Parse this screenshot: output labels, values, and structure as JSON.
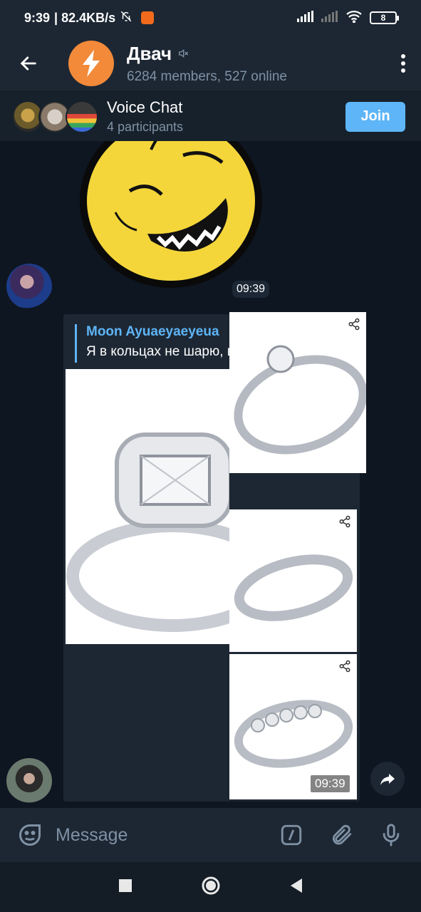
{
  "status": {
    "time": "9:39",
    "speed": "| 82.4KB/s",
    "battery": "8"
  },
  "header": {
    "title": "Двач",
    "subtitle": "6284 members, 527 online"
  },
  "voice_chat": {
    "title": "Voice Chat",
    "participants": "4 participants",
    "join_label": "Join"
  },
  "messages": {
    "sticker_time": "09:39",
    "reply_name": "Moon Ayuaeyaeyeua",
    "reply_text": "Я в кольцах не шарю, висиум пе",
    "album_time": "09:39"
  },
  "input": {
    "placeholder": "Message"
  },
  "colors": {
    "accent": "#5eb5f7",
    "background": "#0e1621",
    "panel": "#1d2733",
    "muted": "#7f91a4",
    "group_avatar": "#f28a3a"
  }
}
